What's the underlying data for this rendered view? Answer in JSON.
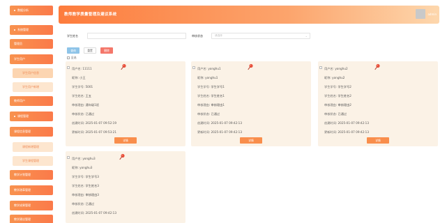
{
  "sidebar": {
    "items": [
      {
        "label": "数据分析",
        "type": "main"
      },
      {
        "label": "系统管理",
        "type": "main"
      },
      {
        "label": "管理员",
        "type": "main"
      },
      {
        "label": "学生用户",
        "type": "main"
      },
      {
        "label": "学生用户信息",
        "type": "sub",
        "active": true
      },
      {
        "label": "学生用户新增",
        "type": "sub"
      },
      {
        "label": "教师用户",
        "type": "main"
      },
      {
        "label": "课程管理",
        "type": "main"
      },
      {
        "label": "课程信息管理",
        "type": "main"
      },
      {
        "label": "课程新增管理",
        "type": "sub"
      },
      {
        "label": "学生课程管理",
        "type": "sub"
      },
      {
        "label": "教学计划管理",
        "type": "main"
      },
      {
        "label": "教学改革管理",
        "type": "main"
      },
      {
        "label": "教学成果管理",
        "type": "main"
      },
      {
        "label": "教学建议管理",
        "type": "main"
      }
    ]
  },
  "header": {
    "title": "教师教学质量管理及建议系统",
    "user": "admin"
  },
  "search": {
    "name_label": "学生姓名",
    "name_placeholder": "",
    "status_label": "审核状态",
    "status_placeholder": "请选择"
  },
  "actions": {
    "search": "查询",
    "reset": "重置",
    "delete": "删除",
    "select_all": "全选"
  },
  "labels": {
    "username": "用户名:",
    "nickname": "昵称:",
    "student_no": "学生学号:",
    "student_name": "学生姓名:",
    "title": "审核理由:",
    "status": "审核状态:",
    "created": "创建时间:",
    "updated": "更新时间:",
    "detail": "详情"
  },
  "cards": [
    {
      "username": "11111",
      "nickname": "小王",
      "student_no": "5001",
      "student_name": "王五",
      "title": "通年级1班",
      "status": "已通过",
      "created": "2025-01-07 09:52:19",
      "updated": "2025-01-07 09:53:21"
    },
    {
      "username": "yonghu1",
      "nickname": "yonghu1",
      "student_no": "学生学号1",
      "student_name": "学生姓名1",
      "title": "审核理由1",
      "status": "已通过",
      "created": "2025-01-07 09:42:13",
      "updated": "2025-01-07 09:42:13"
    },
    {
      "username": "yonghu2",
      "nickname": "yonghu2",
      "student_no": "学生学号2",
      "student_name": "学生姓名2",
      "title": "审核理由2",
      "status": "已通过",
      "created": "2025-01-07 09:42:13",
      "updated": "2025-01-07 09:42:13"
    },
    {
      "username": "yonghu3",
      "nickname": "yonghu3",
      "student_no": "学生学号3",
      "student_name": "学生姓名3",
      "title": "审核理由3",
      "status": "已通过",
      "created": "2025-01-07 09:42:13",
      "updated": ""
    }
  ],
  "colors": {
    "accent": "#f98e4c",
    "card_bg": "#fbf2e6",
    "delete": "#f4776a",
    "search": "#8ec4e8"
  }
}
